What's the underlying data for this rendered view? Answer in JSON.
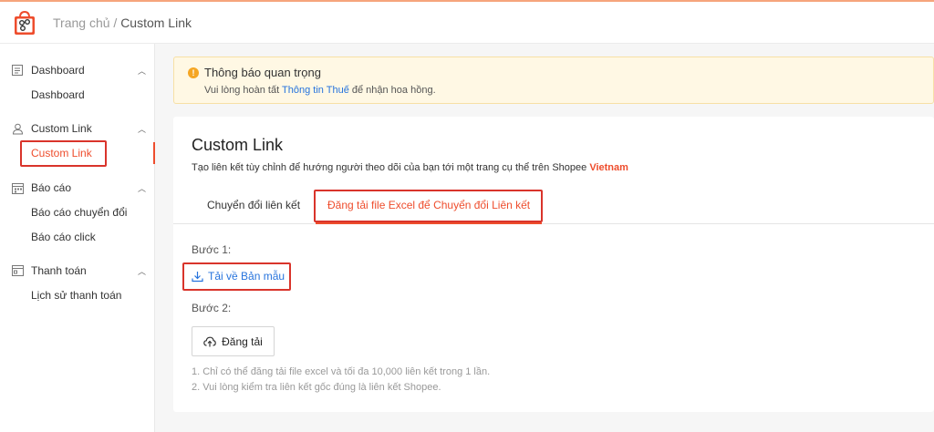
{
  "breadcrumb": {
    "home": "Trang chủ",
    "separator": " / ",
    "current": "Custom Link"
  },
  "sidebar": {
    "groups": [
      {
        "title": "Dashboard",
        "icon": "dashboard-icon",
        "items": [
          "Dashboard"
        ]
      },
      {
        "title": "Custom Link",
        "icon": "user-link-icon",
        "items": [
          "Custom Link"
        ]
      },
      {
        "title": "Báo cáo",
        "icon": "calendar-icon",
        "items": [
          "Báo cáo chuyển đổi",
          "Báo cáo click"
        ]
      },
      {
        "title": "Thanh toán",
        "icon": "wallet-icon",
        "items": [
          "Lịch sử thanh toán"
        ]
      }
    ]
  },
  "notice": {
    "title": "Thông báo quan trọng",
    "text_before": "Vui lòng hoàn tất ",
    "link": "Thông tin Thuế",
    "text_after": " để nhận hoa hồng."
  },
  "main": {
    "title": "Custom Link",
    "description": "Tạo liên kết tùy chỉnh để hướng người theo dõi của bạn tới một trang cụ thể trên Shopee ",
    "description_highlight": "Vietnam",
    "tabs": [
      {
        "label": "Chuyển đổi liên kết"
      },
      {
        "label": "Đăng tải file Excel để Chuyển đổi Liên kết"
      }
    ],
    "step1": "Bước 1:",
    "download_label": "Tải về Bản mẫu",
    "step2": "Bước 2:",
    "upload_label": "Đăng tải",
    "notes": [
      "1. Chỉ có thể đăng tải file excel và tối đa 10,000 liên kết trong 1 lần.",
      "2. Vui lòng kiểm tra liên kết gốc đúng là liên kết Shopee."
    ]
  },
  "colors": {
    "accent": "#ee4d2d",
    "link": "#2673dd",
    "highlight_box": "#d9342b",
    "notice_bg": "#fff8e4"
  }
}
